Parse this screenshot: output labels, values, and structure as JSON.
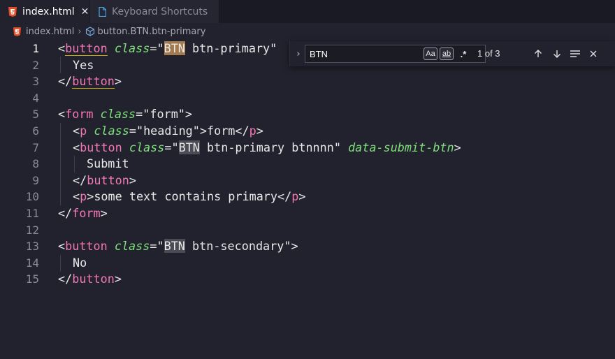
{
  "tabs": [
    {
      "label": "index.html",
      "icon": "html5-icon",
      "close": "✕",
      "active": true
    },
    {
      "label": "Keyboard Shortcuts",
      "icon": "file-icon",
      "active": false
    }
  ],
  "breadcrumb": {
    "file": "index.html",
    "separator": "›",
    "symbol": "button.BTN.btn-primary"
  },
  "find": {
    "value": "BTN",
    "match_case_label": "Aa",
    "whole_word_label": "ab",
    "regex_label": ".*",
    "result_count": "1 of 3",
    "toggle": "›"
  },
  "editor": {
    "line_numbers": [
      "1",
      "2",
      "3",
      "4",
      "5",
      "6",
      "7",
      "8",
      "9",
      "10",
      "11",
      "12",
      "13",
      "14",
      "15"
    ],
    "lines": {
      "l1": {
        "lt": "<",
        "tag": "button",
        "sp": " ",
        "attr": "class",
        "eq": "=\"",
        "match": "BTN",
        "rest": " btn-primary\""
      },
      "l2": {
        "text": "Yes"
      },
      "l3": {
        "lt": "</",
        "tag": "button",
        "gt": ">"
      },
      "l5": {
        "lt": "<",
        "tag": "form",
        "sp": " ",
        "attr": "class",
        "val": "=\"form\">"
      },
      "l6": {
        "lt": "<",
        "tag": "p",
        "sp": " ",
        "attr": "class",
        "val": "=\"heading\">",
        "text": "form",
        "clt": "</",
        "ctag": "p",
        "cgt": ">"
      },
      "l7": {
        "lt": "<",
        "tag": "button",
        "sp": " ",
        "attr": "class",
        "eq": "=\"",
        "match": "BTN",
        "rest": " btn-primary btnnnn\" ",
        "attr2": "data-submit-btn",
        "gt": ">"
      },
      "l8": {
        "text": "Submit"
      },
      "l9": {
        "lt": "</",
        "tag": "button",
        "gt": ">"
      },
      "l10": {
        "lt": "<",
        "tag": "p",
        "gt": ">",
        "text": "some text contains primary",
        "clt": "</",
        "ctag": "p",
        "cgt": ">"
      },
      "l11": {
        "lt": "</",
        "tag": "form",
        "gt": ">"
      },
      "l13": {
        "lt": "<",
        "tag": "button",
        "sp": " ",
        "attr": "class",
        "eq": "=\"",
        "match": "BTN",
        "rest": " btn-secondary\">"
      },
      "l14": {
        "text": "No"
      },
      "l15": {
        "lt": "</",
        "tag": "button",
        "gt": ">"
      }
    }
  },
  "colors": {
    "background": "#22222e",
    "tag": "#f277b5",
    "attribute": "#7ee07a",
    "current_match": "#a47b4e",
    "match": "#4b4b55"
  }
}
